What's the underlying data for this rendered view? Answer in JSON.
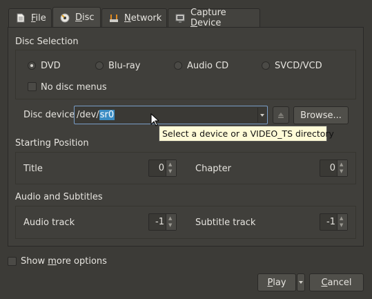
{
  "tabs": [
    {
      "prefix": "",
      "hot": "F",
      "rest": "ile"
    },
    {
      "prefix": "",
      "hot": "D",
      "rest": "isc"
    },
    {
      "prefix": "",
      "hot": "N",
      "rest": "etwork"
    },
    {
      "prefix": "Capture ",
      "hot": "D",
      "rest": "evice"
    }
  ],
  "disc_selection": {
    "title": "Disc Selection",
    "options": [
      "DVD",
      "Blu-ray",
      "Audio CD",
      "SVCD/VCD"
    ],
    "selected": "DVD",
    "no_menus_label": "No disc menus",
    "no_menus_checked": false
  },
  "disc_device": {
    "label": "Disc device",
    "value_prefix": "/dev/",
    "value_selected": "sr0",
    "browse_label": "Browse...",
    "tooltip": "Select a device or a VIDEO_TS directory"
  },
  "starting_position": {
    "title": "Starting Position",
    "title_label": "Title",
    "title_value": "0",
    "chapter_label": "Chapter",
    "chapter_value": "0"
  },
  "audio_subtitles": {
    "title": "Audio and Subtitles",
    "audio_label": "Audio track",
    "audio_value": "-1",
    "subtitle_label": "Subtitle track",
    "subtitle_value": "-1"
  },
  "more_options": {
    "prefix": "Show ",
    "hot": "m",
    "rest": "ore options",
    "checked": false
  },
  "buttons": {
    "play": {
      "prefix": "",
      "hot": "P",
      "rest": "lay"
    },
    "cancel": {
      "prefix": "",
      "hot": "C",
      "rest": "ancel"
    }
  },
  "colors": {
    "background": "#3c3b37",
    "selection": "#3a8cc4",
    "tooltip_bg": "#fffbd7"
  }
}
